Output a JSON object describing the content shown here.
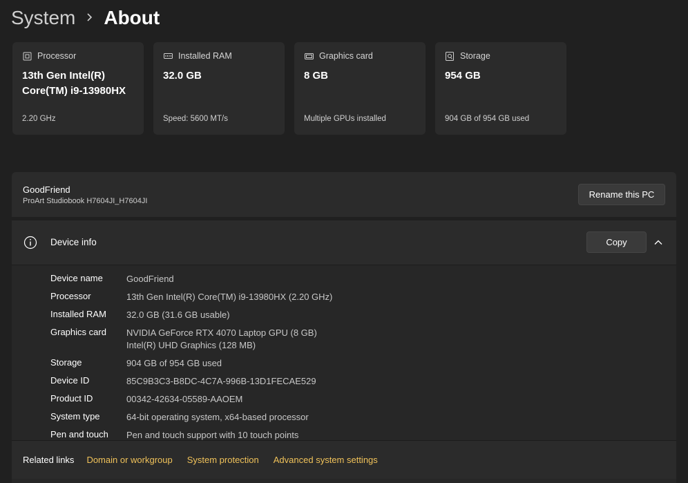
{
  "breadcrumb": {
    "parent": "System",
    "current": "About"
  },
  "cards": [
    {
      "icon": "processor-icon",
      "title": "Processor",
      "value": "13th Gen Intel(R) Core(TM) i9-13980HX",
      "foot": "2.20 GHz"
    },
    {
      "icon": "ram-icon",
      "title": "Installed RAM",
      "value": "32.0 GB",
      "foot": "Speed: 5600 MT/s"
    },
    {
      "icon": "graphics-card-icon",
      "title": "Graphics card",
      "value": "8 GB",
      "foot": "Multiple GPUs installed"
    },
    {
      "icon": "storage-icon",
      "title": "Storage",
      "value": "954 GB",
      "foot": "904 GB of 954 GB used"
    }
  ],
  "pc": {
    "name": "GoodFriend",
    "model": "ProArt Studiobook H7604JI_H7604JI",
    "rename_label": "Rename this PC"
  },
  "device_info": {
    "title": "Device info",
    "copy_label": "Copy",
    "rows": [
      {
        "label": "Device name",
        "values": [
          "GoodFriend"
        ]
      },
      {
        "label": "Processor",
        "values": [
          "13th Gen Intel(R) Core(TM) i9-13980HX (2.20 GHz)"
        ]
      },
      {
        "label": "Installed RAM",
        "values": [
          "32.0 GB (31.6 GB usable)"
        ]
      },
      {
        "label": "Graphics card",
        "values": [
          "NVIDIA GeForce RTX 4070 Laptop GPU (8 GB)",
          "Intel(R) UHD Graphics (128 MB)"
        ]
      },
      {
        "label": "Storage",
        "values": [
          "904 GB of 954 GB used"
        ]
      },
      {
        "label": "Device ID",
        "values": [
          "85C9B3C3-B8DC-4C7A-996B-13D1FECAE529"
        ]
      },
      {
        "label": "Product ID",
        "values": [
          "00342-42634-05589-AAOEM"
        ]
      },
      {
        "label": "System type",
        "values": [
          "64-bit operating system, x64-based processor"
        ]
      },
      {
        "label": "Pen and touch",
        "values": [
          "Pen and touch support with 10 touch points"
        ]
      }
    ]
  },
  "related": {
    "title": "Related links",
    "links": [
      "Domain or workgroup",
      "System protection",
      "Advanced system settings"
    ]
  },
  "colors": {
    "background": "#202020",
    "card": "#2b2b2b",
    "link": "#f0c25a"
  }
}
